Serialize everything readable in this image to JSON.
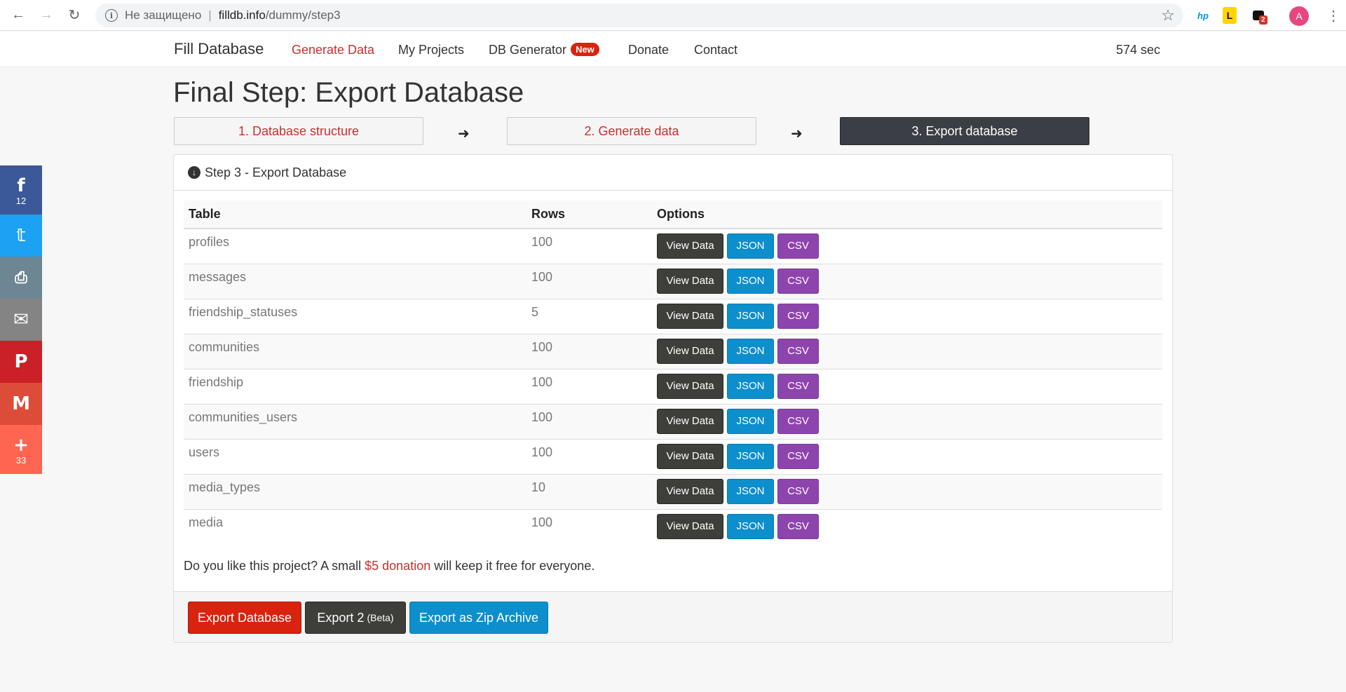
{
  "browser": {
    "insecure_label": "Не защищено",
    "separator": "|",
    "url_host": "filldb.info",
    "url_path": "/dummy/step3",
    "avatar_letter": "A",
    "ext_badge": "2",
    "ext_hp": "hp",
    "ext_l": "L"
  },
  "navbar": {
    "brand": "Fill Database",
    "links": [
      "Generate Data",
      "My Projects",
      "DB Generator",
      "Donate",
      "Contact"
    ],
    "new_badge": "New",
    "timer": "574 sec",
    "active_color": "#c9302c"
  },
  "page": {
    "title": "Final Step: Export Database",
    "steps": [
      "1. Database structure",
      "2. Generate data",
      "3. Export database"
    ],
    "current_step": 3
  },
  "panel": {
    "heading": "Step 3 - Export Database",
    "columns": [
      "Table",
      "Rows",
      "Options"
    ],
    "rows": [
      {
        "table": "profiles",
        "rows": "100"
      },
      {
        "table": "messages",
        "rows": "100"
      },
      {
        "table": "friendship_statuses",
        "rows": "5"
      },
      {
        "table": "communities",
        "rows": "100"
      },
      {
        "table": "friendship",
        "rows": "100"
      },
      {
        "table": "communities_users",
        "rows": "100"
      },
      {
        "table": "users",
        "rows": "100"
      },
      {
        "table": "media_types",
        "rows": "10"
      },
      {
        "table": "media",
        "rows": "100"
      }
    ],
    "option_labels": {
      "view": "View Data",
      "json": "JSON",
      "csv": "CSV"
    },
    "donate_prefix": "Do you like this project? A small ",
    "donate_link": "$5 donation",
    "donate_suffix": " will keep it free for everyone.",
    "footer_buttons": {
      "export": "Export Database",
      "export2": "Export 2",
      "export2_note": "(Beta)",
      "zip": "Export as Zip Archive"
    }
  },
  "social": {
    "facebook_count": "12",
    "share_count": "33"
  },
  "colors": {
    "danger": "#d9230f",
    "dark": "#3e3f3a",
    "info": "#0c8fcc",
    "purple": "#8e44ad"
  }
}
